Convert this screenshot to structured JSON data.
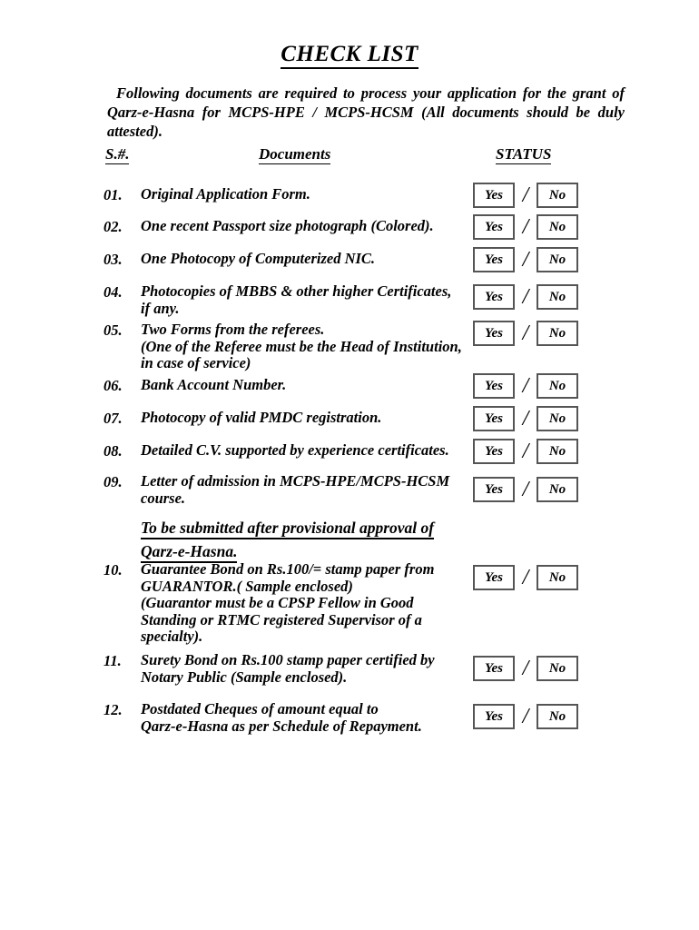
{
  "document": {
    "title": "CHECK LIST",
    "intro": "Following documents are required to process your application for the grant of Qarz-e-Hasna for MCPS-HPE / MCPS-HCSM (All documents should be duly attested).",
    "headers": {
      "serial": "S.#.",
      "documents": "Documents",
      "status": "STATUS"
    },
    "status_options": {
      "yes": "Yes",
      "no": "No",
      "separator": "/"
    },
    "section_heading": {
      "line1": "To be submitted after provisional approval of",
      "line2": "Qarz-e-Hasna."
    },
    "items": [
      {
        "number": "01.",
        "lines": [
          "Original Application Form."
        ],
        "yes": "Yes",
        "no": "No"
      },
      {
        "number": "02.",
        "lines": [
          "One recent Passport size photograph (Colored)."
        ],
        "yes": "Yes",
        "no": "No"
      },
      {
        "number": "03.",
        "lines": [
          "One Photocopy of Computerized NIC."
        ],
        "yes": "Yes",
        "no": "No"
      },
      {
        "number": "04.",
        "lines": [
          "Photocopies of MBBS & other higher Certificates,",
          "if any."
        ],
        "yes": "Yes",
        "no": "No"
      },
      {
        "number": "05.",
        "lines": [
          "Two Forms from the referees.",
          "(One of the Referee must be the Head of Institution,",
          "in case of service)"
        ],
        "yes": "Yes",
        "no": "No"
      },
      {
        "number": "06.",
        "lines": [
          "Bank Account Number."
        ],
        "yes": "Yes",
        "no": "No"
      },
      {
        "number": "07.",
        "lines": [
          "Photocopy of valid PMDC registration."
        ],
        "yes": "Yes",
        "no": "No"
      },
      {
        "number": "08.",
        "lines": [
          "Detailed C.V. supported by experience certificates."
        ],
        "yes": "Yes",
        "no": "No"
      },
      {
        "number": "09.",
        "lines": [
          "Letter of admission in MCPS-HPE/MCPS-HCSM",
          "course."
        ],
        "yes": "Yes",
        "no": "No"
      },
      {
        "number": "10.",
        "lines": [
          "Guarantee Bond on Rs.100/= stamp paper from",
          "GUARANTOR.( Sample enclosed)",
          "(Guarantor must be a CPSP Fellow in Good",
          "Standing or RTMC registered Supervisor of a",
          "specialty)."
        ],
        "yes": "Yes",
        "no": "No"
      },
      {
        "number": "11.",
        "lines": [
          "Surety Bond on Rs.100 stamp paper certified by",
          "Notary Public (Sample enclosed)."
        ],
        "yes": "Yes",
        "no": "No"
      },
      {
        "number": "12.",
        "lines": [
          "Postdated Cheques of amount equal to",
          "Qarz-e-Hasna as per Schedule of Repayment."
        ],
        "yes": "Yes",
        "no": "No"
      }
    ]
  },
  "layout": {
    "item_tops": [
      205,
      240,
      276,
      312,
      354,
      415,
      451,
      487,
      521,
      618,
      718,
      772
    ],
    "status_tops": [
      201,
      236,
      272,
      313,
      353,
      411,
      447,
      483,
      525,
      622,
      722,
      775
    ]
  }
}
